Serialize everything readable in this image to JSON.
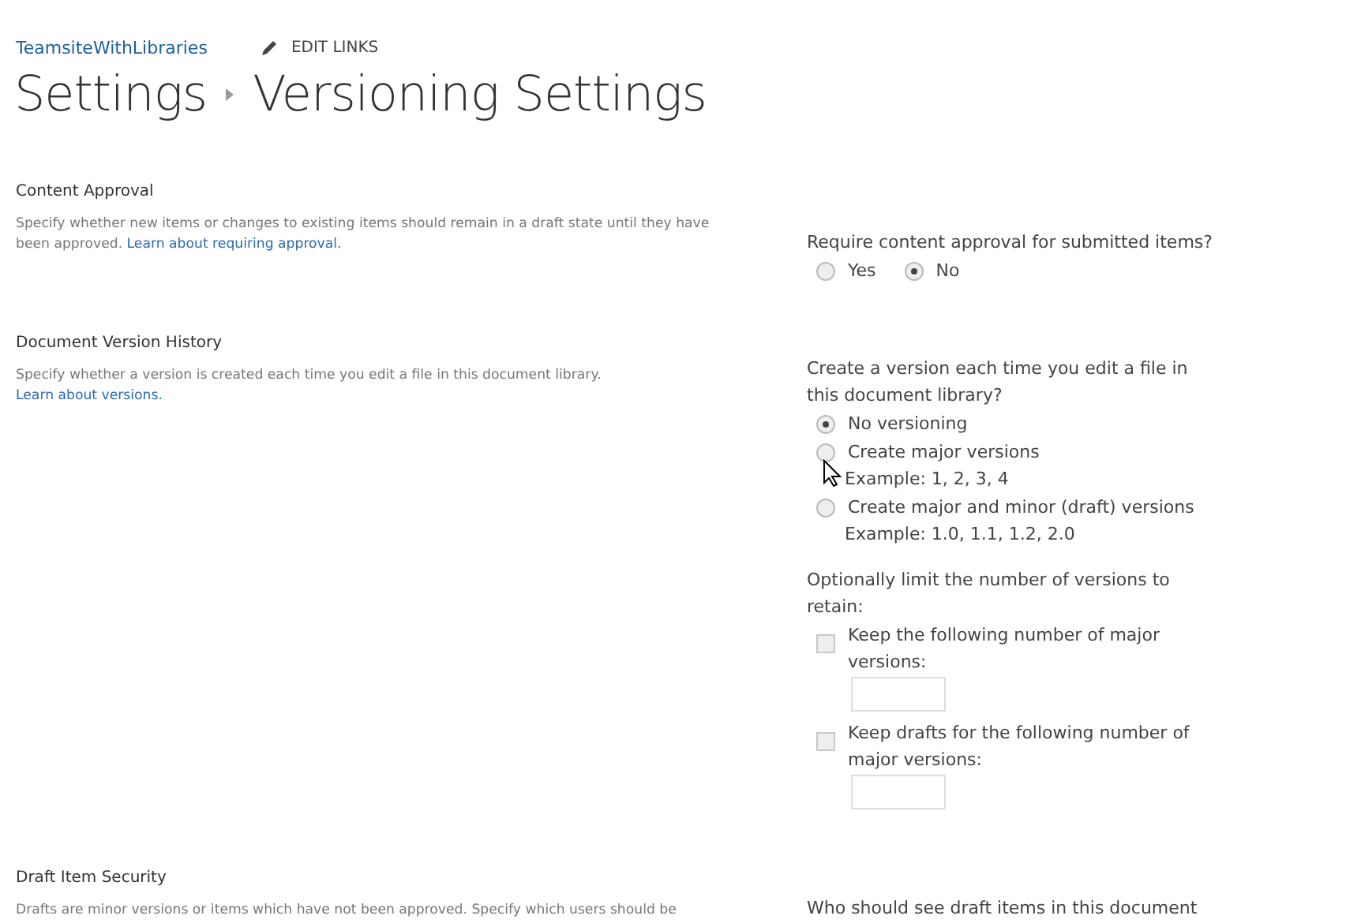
{
  "top_nav": {
    "site_link": "TeamsiteWithLibraries",
    "edit_links": "EDIT LINKS"
  },
  "breadcrumb": [
    "Settings",
    "Versioning Settings"
  ],
  "sections": [
    {
      "title": "Content Approval",
      "description": "Specify whether new items or changes to existing items should remain in a draft state until they have been approved.",
      "link": "Learn about requiring approval.",
      "groups": [
        {
          "question": "Require content approval for submitted items?",
          "kind": "inline-radios",
          "options": [
            {
              "label": "Yes",
              "selected": false
            },
            {
              "label": "No",
              "selected": true
            }
          ]
        }
      ]
    },
    {
      "title": "Document Version History",
      "description": "Specify whether a version is created each time you edit a file in this document library.",
      "link": "Learn about versions.",
      "groups": [
        {
          "question": "Create a version each time you edit a file in this document library?",
          "kind": "radios",
          "options": [
            {
              "label": "No versioning",
              "selected": true
            },
            {
              "label": "Create major versions",
              "example": "Example: 1, 2, 3, 4",
              "selected": false
            },
            {
              "label": "Create major and minor (draft) versions",
              "example": "Example: 1.0, 1.1, 1.2, 2.0",
              "selected": false
            }
          ]
        },
        {
          "question": "Optionally limit the number of versions to retain:",
          "kind": "checkboxes",
          "options": [
            {
              "label": "Keep the following number of major versions:",
              "checked": false
            },
            {
              "label": "Keep drafts for the following number of major versions:",
              "checked": false
            }
          ]
        }
      ]
    },
    {
      "title": "Draft Item Security",
      "description": "Drafts are minor versions or items which have not been approved. Specify which users should be",
      "groups": [
        {
          "question": "Who should see draft items in this document",
          "kind": "question-only"
        }
      ]
    }
  ]
}
